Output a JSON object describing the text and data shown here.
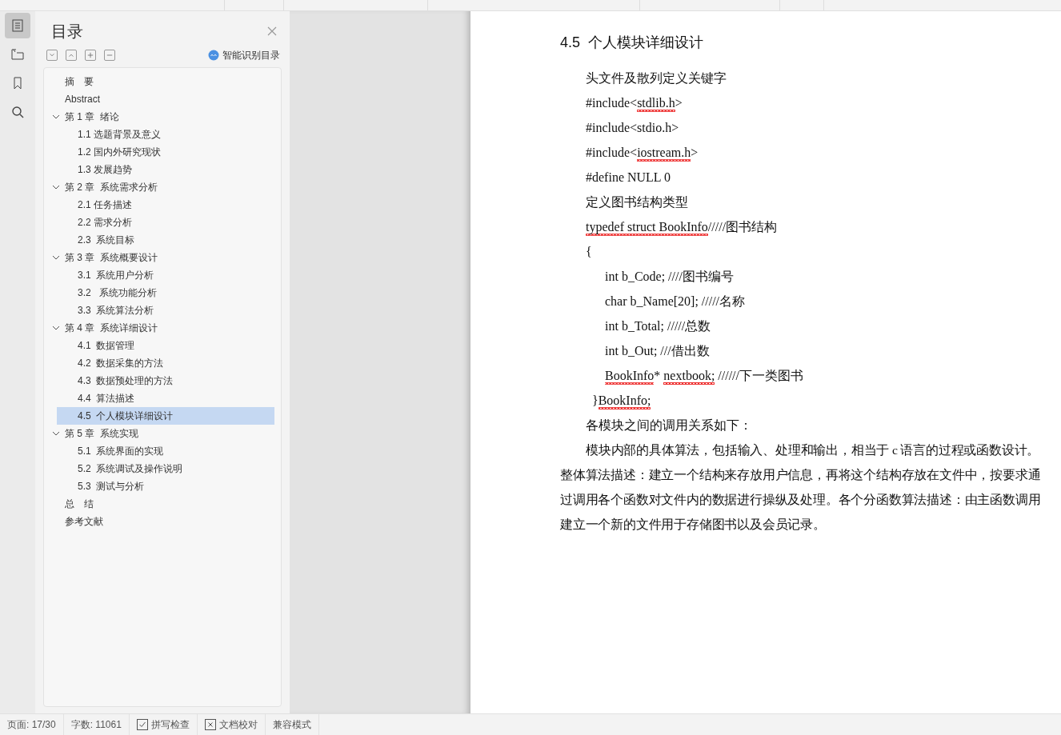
{
  "sidebar": {
    "tools": [
      {
        "kind": "toc",
        "selected": true
      },
      {
        "kind": "navigation",
        "selected": false
      },
      {
        "kind": "bookmark",
        "selected": false
      },
      {
        "kind": "search",
        "selected": false
      }
    ]
  },
  "toc": {
    "title": "目录",
    "smart_button": "智能识别目录",
    "items": [
      {
        "label": "摘　要",
        "selected": false
      },
      {
        "label": "Abstract",
        "selected": false
      },
      {
        "label": "第 1 章  绪论",
        "selected": false,
        "expanded": true,
        "children": [
          {
            "label": "1.1 选题背景及意义",
            "selected": false
          },
          {
            "label": "1.2 国内外研究现状",
            "selected": false
          },
          {
            "label": "1.3 发展趋势",
            "selected": false
          }
        ]
      },
      {
        "label": "第 2 章  系统需求分析",
        "selected": false,
        "expanded": true,
        "children": [
          {
            "label": "2.1 任务描述",
            "selected": false
          },
          {
            "label": "2.2 需求分析",
            "selected": false
          },
          {
            "label": "2.3  系统目标",
            "selected": false
          }
        ]
      },
      {
        "label": "第 3 章  系统概要设计",
        "selected": false,
        "expanded": true,
        "children": [
          {
            "label": "3.1  系统用户分析",
            "selected": false
          },
          {
            "label": "3.2   系统功能分析",
            "selected": false
          },
          {
            "label": "3.3  系统算法分析",
            "selected": false
          }
        ]
      },
      {
        "label": "第 4 章  系统详细设计",
        "selected": false,
        "expanded": true,
        "children": [
          {
            "label": "4.1  数据管理",
            "selected": false
          },
          {
            "label": "4.2  数据采集的方法",
            "selected": false
          },
          {
            "label": "4.3  数据预处理的方法",
            "selected": false
          },
          {
            "label": "4.4  算法描述",
            "selected": false
          },
          {
            "label": "4.5  个人模块详细设计",
            "selected": true
          }
        ]
      },
      {
        "label": "第 5 章  系统实现",
        "selected": false,
        "expanded": true,
        "children": [
          {
            "label": "5.1  系统界面的实现",
            "selected": false
          },
          {
            "label": "5.2  系统调试及操作说明",
            "selected": false
          },
          {
            "label": "5.3  测试与分析",
            "selected": false
          }
        ]
      },
      {
        "label": "总　结",
        "selected": false
      },
      {
        "label": "参考文献",
        "selected": false
      }
    ]
  },
  "document": {
    "heading": "4.5  个人模块详细设计",
    "lines": [
      {
        "kind": "body",
        "segments": [
          {
            "text": "头文件及散列定义关键字",
            "misspelled": false
          }
        ]
      },
      {
        "kind": "body",
        "segments": [
          {
            "text": "#include<",
            "misspelled": false
          },
          {
            "text": "stdlib.h",
            "misspelled": true
          },
          {
            "text": ">",
            "misspelled": false
          }
        ]
      },
      {
        "kind": "body",
        "segments": [
          {
            "text": "#include<stdio.h>",
            "misspelled": false
          }
        ]
      },
      {
        "kind": "body",
        "segments": [
          {
            "text": "#include<",
            "misspelled": false
          },
          {
            "text": "iostream.h",
            "misspelled": true
          },
          {
            "text": ">",
            "misspelled": false
          }
        ]
      },
      {
        "kind": "body",
        "segments": [
          {
            "text": "#define NULL 0",
            "misspelled": false
          }
        ]
      },
      {
        "kind": "body",
        "segments": [
          {
            "text": "定义图书结构类型",
            "misspelled": false
          }
        ]
      },
      {
        "kind": "body",
        "segments": [
          {
            "text": "typedef struct BookInfo",
            "misspelled": true
          },
          {
            "text": "/////图书结构",
            "misspelled": false
          }
        ]
      },
      {
        "kind": "body",
        "segments": [
          {
            "text": "{",
            "misspelled": false
          }
        ]
      },
      {
        "kind": "member",
        "segments": [
          {
            "text": "int b_Code; ////图书编号",
            "misspelled": false
          }
        ]
      },
      {
        "kind": "member",
        "segments": [
          {
            "text": "char b_Name[20]; /////名称",
            "misspelled": false
          }
        ]
      },
      {
        "kind": "member",
        "segments": [
          {
            "text": "int b_Total; /////总数",
            "misspelled": false
          }
        ]
      },
      {
        "kind": "member",
        "segments": [
          {
            "text": "int b_Out; ///借出数",
            "misspelled": false
          }
        ]
      },
      {
        "kind": "member",
        "segments": [
          {
            "text": "BookInfo",
            "misspelled": true
          },
          {
            "text": "* ",
            "misspelled": false
          },
          {
            "text": "nextbook;",
            "misspelled": true
          },
          {
            "text": " //////下一类图书",
            "misspelled": false
          }
        ]
      },
      {
        "kind": "closing",
        "segments": [
          {
            "text": "}",
            "misspelled": false
          },
          {
            "text": "BookInfo;",
            "misspelled": true
          }
        ]
      },
      {
        "kind": "body",
        "segments": [
          {
            "text": "各模块之间的调用关系如下：",
            "misspelled": false
          }
        ]
      },
      {
        "kind": "paragraph",
        "segments": [
          {
            "text": "模块内部的具体算法，包括输入、处理和输出，相当于 c 语言的过程或函数设计。整体算法描述：建立一个结构来存放用户信息，再将这个结构存放在文件中，按要求通过调用各个函数对文件内的数据进行操纵及处理。各个分函数算法描述：由主函数调用建立一个新的文件用于存储图书以及会员记录。",
            "misspelled": false
          }
        ]
      }
    ]
  },
  "status_bar": [
    {
      "kind": "text",
      "label": "页面: 17/30"
    },
    {
      "kind": "text",
      "label": "字数: 11061"
    },
    {
      "kind": "check",
      "label": "拼写检查"
    },
    {
      "kind": "cross",
      "label": "文档校对"
    },
    {
      "kind": "text",
      "label": "兼容模式"
    }
  ]
}
